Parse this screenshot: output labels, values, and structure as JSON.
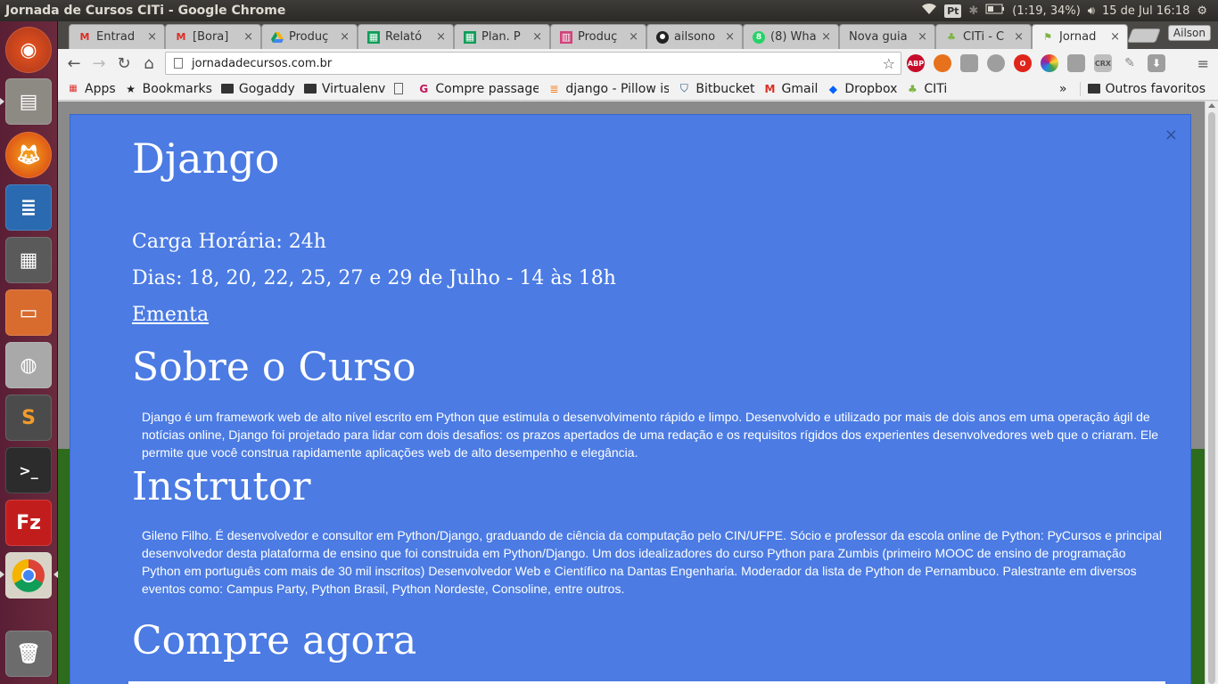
{
  "system": {
    "window_title": "Jornada de Cursos CITi - Google Chrome",
    "keyboard_layout": "Pt",
    "battery": "(1:19, 34%)",
    "datetime": "15 de Jul 16:18"
  },
  "launcher": {
    "items": [
      "ubuntu-dash",
      "files",
      "firefox",
      "libreoffice-writer",
      "system-monitor",
      "libreoffice-impress",
      "disks",
      "sublime-text",
      "terminal",
      "filezilla",
      "chrome",
      "trash"
    ]
  },
  "tabs": [
    {
      "label": "Entrad",
      "icon": "gmail-icon"
    },
    {
      "label": "[Bora]",
      "icon": "gmail-icon"
    },
    {
      "label": "Produç",
      "icon": "drive-icon"
    },
    {
      "label": "Relató",
      "icon": "sheets-icon"
    },
    {
      "label": "Plan. P",
      "icon": "sheets-icon"
    },
    {
      "label": "Produç",
      "icon": "trello-icon"
    },
    {
      "label": "ailsono",
      "icon": "github-icon"
    },
    {
      "label": "(8) Wha",
      "icon": "whatsapp-icon"
    },
    {
      "label": "Nova guia",
      "icon": ""
    },
    {
      "label": "CITi - C",
      "icon": "citi-icon"
    },
    {
      "label": "Jornad",
      "icon": "citi-flag-icon",
      "active": true
    }
  ],
  "profile_name": "Ailson",
  "omnibox": {
    "url": "jornadadecursos.com.br"
  },
  "bookmarks": [
    {
      "label": "Apps",
      "icon": "apps-icon"
    },
    {
      "label": "Bookmarks",
      "icon": "star-icon"
    },
    {
      "label": "Gogaddy",
      "icon": "folder-icon"
    },
    {
      "label": "Virtualenv",
      "icon": "folder-icon"
    },
    {
      "label": "",
      "icon": "page-icon"
    },
    {
      "label": "Compre passage",
      "icon": "g-icon"
    },
    {
      "label": "django - Pillow is",
      "icon": "stackoverflow-icon"
    },
    {
      "label": "Bitbucket",
      "icon": "bitbucket-icon"
    },
    {
      "label": "Gmail",
      "icon": "gmail-icon"
    },
    {
      "label": "Dropbox",
      "icon": "dropbox-icon"
    },
    {
      "label": "CITi",
      "icon": "citi-icon"
    }
  ],
  "other_bookmarks": "Outros favoritos",
  "overflow": "»",
  "modal": {
    "close": "×",
    "title": "Django",
    "workload": "Carga Horária: 24h",
    "days": "Dias: 18, 20, 22, 25, 27 e 29 de Julho - 14 às 18h",
    "syllabus_link": "Ementa",
    "about_heading": "Sobre o Curso",
    "about_text": "Django é um framework web de alto nível escrito em Python que estimula o desenvolvimento rápido e limpo. Desenvolvido e utilizado por mais de dois anos em uma operação ágil de notícias online, Django foi projetado para lidar com dois desafios: os prazos apertados de uma redação e os requisitos rígidos dos experientes desenvolvedores web que o criaram. Ele permite que você construa rapidamente aplicações web de alto desempenho e elegância.",
    "instructor_heading": "Instrutor",
    "instructor_text": "Gileno Filho. É desenvolvedor e consultor em Python/Django, graduando de ciência da computação pelo CIN/UFPE. Sócio e professor da escola online de Python: PyCursos e principal desenvolvedor desta plataforma de ensino que foi construida em Python/Django. Um dos idealizadores do curso Python para Zumbis (primeiro MOOC de ensino de programação Python em português com mais de 30 mil inscritos) Desenvolvedor Web e Científico na Dantas Engenharia. Moderador da lista de Python de Pernambuco. Palestrante em diversos eventos como: Campus Party, Python Brasil, Python Nordeste, Consoline, entre outros.",
    "buy_heading": "Compre agora"
  },
  "colors": {
    "modal_bg": "#4b7be3",
    "page_green": "#2d6b1d",
    "launcher_bg": "#6b2a3d"
  }
}
